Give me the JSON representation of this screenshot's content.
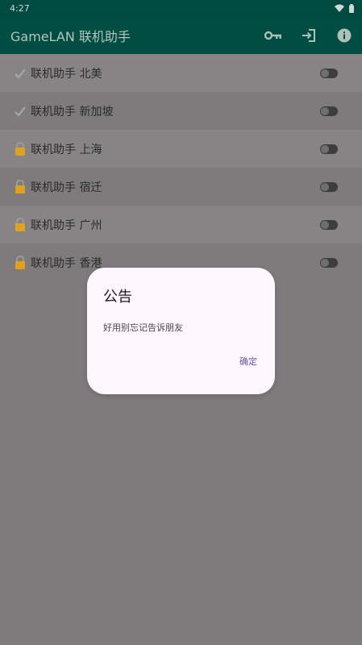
{
  "status_bar": {
    "time": "4:27"
  },
  "app_bar": {
    "title": "GameLAN 联机助手",
    "actions": [
      "key-icon",
      "login-icon",
      "info-icon"
    ]
  },
  "servers": [
    {
      "label": "联机助手 北美",
      "icon": "checkmark-icon",
      "enabled": false
    },
    {
      "label": "联机助手 新加坡",
      "icon": "checkmark-icon",
      "enabled": false
    },
    {
      "label": "联机助手 上海",
      "icon": "lock-icon",
      "enabled": false
    },
    {
      "label": "联机助手 宿迁",
      "icon": "lock-icon",
      "enabled": false
    },
    {
      "label": "联机助手 广州",
      "icon": "lock-icon",
      "enabled": false
    },
    {
      "label": "联机助手 香港",
      "icon": "lock-icon",
      "enabled": false
    }
  ],
  "dialog": {
    "title": "公告",
    "message": "好用别忘记告诉朋友",
    "confirm_label": "确定"
  },
  "colors": {
    "app_bar": "#004d42",
    "scrim_background": "#7e7b7d",
    "dialog_background": "#fdf6fd",
    "accent": "#6a55a8",
    "lock": "#e0a21c"
  }
}
